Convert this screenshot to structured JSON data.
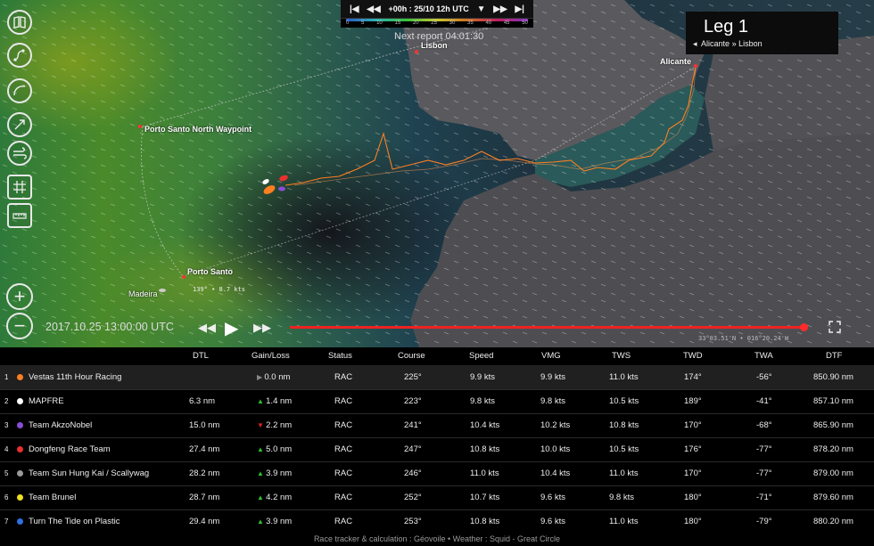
{
  "topbar": {
    "first": "K",
    "prev": "<<",
    "time_label": "+00h : 25/10 12h UTC",
    "next": ">>",
    "last": ">|"
  },
  "scale_ticks": [
    "0",
    "5",
    "10",
    "15",
    "20",
    "25",
    "30",
    "35",
    "40",
    "45",
    "50"
  ],
  "next_report": "Next report 04:01:30",
  "leg": {
    "title": "Leg 1",
    "route_prefix": "◂",
    "route": "Alicante » Lisbon"
  },
  "places": {
    "lisbon": "Lisbon",
    "alicante": "Alicante",
    "porto_santo_north": "Porto Santo North Waypoint",
    "porto_santo": "Porto Santo",
    "madeira": "Madeira"
  },
  "wind_label": "139° • 8.7 kts",
  "timestamp": "2017.10.25 13:00:00 UTC",
  "timeline_progress": 0.99,
  "coords": "33°03.51'N • 016°20.24'W",
  "zoom": {
    "in": "+",
    "out": "−"
  },
  "columns": [
    "DTL",
    "Gain/Loss",
    "Status",
    "Course",
    "Speed",
    "VMG",
    "TWS",
    "TWD",
    "TWA",
    "DTF"
  ],
  "rows": [
    {
      "rank": "1",
      "color": "#ff7f20",
      "name": "Vestas 11th Hour Racing",
      "dtl": "",
      "trend": "none",
      "gain": "0.0 nm",
      "status": "RAC",
      "course": "225°",
      "speed": "9.9 kts",
      "vmg": "9.9 kts",
      "tws": "11.0 kts",
      "twd": "174°",
      "twa": "-56°",
      "dtf": "850.90 nm"
    },
    {
      "rank": "2",
      "color": "#ffffff",
      "name": "MAPFRE",
      "dtl": "6.3 nm",
      "trend": "up",
      "gain": "1.4 nm",
      "status": "RAC",
      "course": "223°",
      "speed": "9.8 kts",
      "vmg": "9.8 kts",
      "tws": "10.5 kts",
      "twd": "189°",
      "twa": "-41°",
      "dtf": "857.10 nm"
    },
    {
      "rank": "3",
      "color": "#8a4dd8",
      "name": "Team AkzoNobel",
      "dtl": "15.0 nm",
      "trend": "down",
      "gain": "2.2 nm",
      "status": "RAC",
      "course": "241°",
      "speed": "10.4 kts",
      "vmg": "10.2 kts",
      "tws": "10.8 kts",
      "twd": "170°",
      "twa": "-68°",
      "dtf": "865.90 nm"
    },
    {
      "rank": "4",
      "color": "#e83030",
      "name": "Dongfeng Race Team",
      "dtl": "27.4 nm",
      "trend": "up",
      "gain": "5.0 nm",
      "status": "RAC",
      "course": "247°",
      "speed": "10.8 kts",
      "vmg": "10.0 kts",
      "tws": "10.5 kts",
      "twd": "176°",
      "twa": "-77°",
      "dtf": "878.20 nm"
    },
    {
      "rank": "5",
      "color": "#9a9a9a",
      "name": "Team Sun Hung Kai / Scallywag",
      "dtl": "28.2 nm",
      "trend": "up",
      "gain": "3.9 nm",
      "status": "RAC",
      "course": "246°",
      "speed": "11.0 kts",
      "vmg": "10.4 kts",
      "tws": "11.0 kts",
      "twd": "170°",
      "twa": "-77°",
      "dtf": "879.00 nm"
    },
    {
      "rank": "6",
      "color": "#f0e020",
      "name": "Team Brunel",
      "dtl": "28.7 nm",
      "trend": "up",
      "gain": "4.2 nm",
      "status": "RAC",
      "course": "252°",
      "speed": "10.7 kts",
      "vmg": "9.6 kts",
      "tws": "9.8 kts",
      "twd": "180°",
      "twa": "-71°",
      "dtf": "879.60 nm"
    },
    {
      "rank": "7",
      "color": "#3070e0",
      "name": "Turn The Tide on Plastic",
      "dtl": "29.4 nm",
      "trend": "up",
      "gain": "3.9 nm",
      "status": "RAC",
      "course": "253°",
      "speed": "10.8 kts",
      "vmg": "9.6 kts",
      "tws": "11.0 kts",
      "twd": "180°",
      "twa": "-79°",
      "dtf": "880.20 nm"
    }
  ],
  "footer": "Race tracker & calculation : Géovoile • Weather : Squid - Great Circle"
}
